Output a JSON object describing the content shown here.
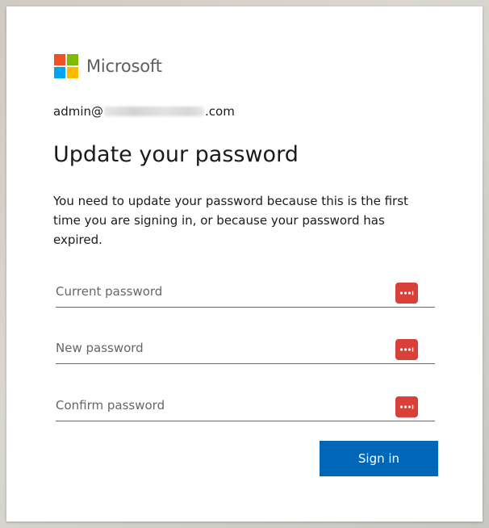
{
  "brand": {
    "name": "Microsoft",
    "colors": {
      "red": "#f25022",
      "green": "#7fba00",
      "blue": "#00a4ef",
      "yellow": "#ffb900"
    }
  },
  "account": {
    "prefix": "admin@",
    "suffix": ".com"
  },
  "page": {
    "title": "Update your password",
    "description": "You need to update your password because this is the first time you are signing in, or because your password has expired."
  },
  "fields": {
    "current_password": {
      "placeholder": "Current password",
      "value": ""
    },
    "new_password": {
      "placeholder": "New password",
      "value": ""
    },
    "confirm_password": {
      "placeholder": "Confirm password",
      "value": ""
    },
    "icon": "password-manager-icon",
    "icon_color": "#d9403a"
  },
  "actions": {
    "sign_in_label": "Sign in",
    "accent": "#0067b8"
  }
}
